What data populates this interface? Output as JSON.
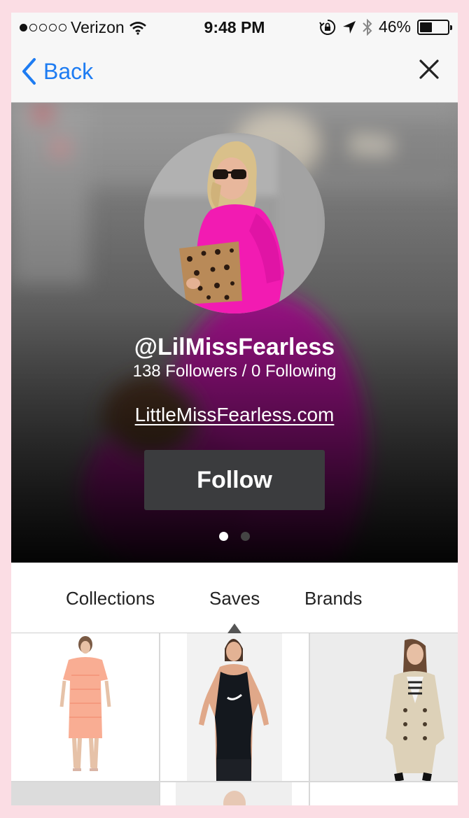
{
  "status_bar": {
    "carrier": "Verizon",
    "time": "9:48 PM",
    "battery": "46%",
    "battery_level": 0.46,
    "signal_dots_filled": 1,
    "signal_dots_total": 5,
    "icons": [
      "wifi-icon",
      "rotation-lock-icon",
      "location-arrow-icon",
      "bluetooth-icon",
      "battery-icon"
    ]
  },
  "nav": {
    "back_label": "Back",
    "back_icon": "chevron-left-icon",
    "close_icon": "close-icon",
    "accent_color": "#1e7cf2"
  },
  "profile": {
    "handle": "@LilMissFearless",
    "stats": "138 Followers / 0 Following",
    "website": "LittleMissFearless.com",
    "follow_label": "Follow",
    "page_count": 2,
    "active_page": 0
  },
  "tabs": {
    "items": [
      {
        "label": "Collections",
        "active": false
      },
      {
        "label": "Saves",
        "active": true
      },
      {
        "label": "Brands",
        "active": false
      }
    ]
  },
  "grid": {
    "items": [
      {
        "name": "peach-lace-dress"
      },
      {
        "name": "black-nike-tank-top"
      },
      {
        "name": "beige-trench-coat"
      }
    ]
  }
}
